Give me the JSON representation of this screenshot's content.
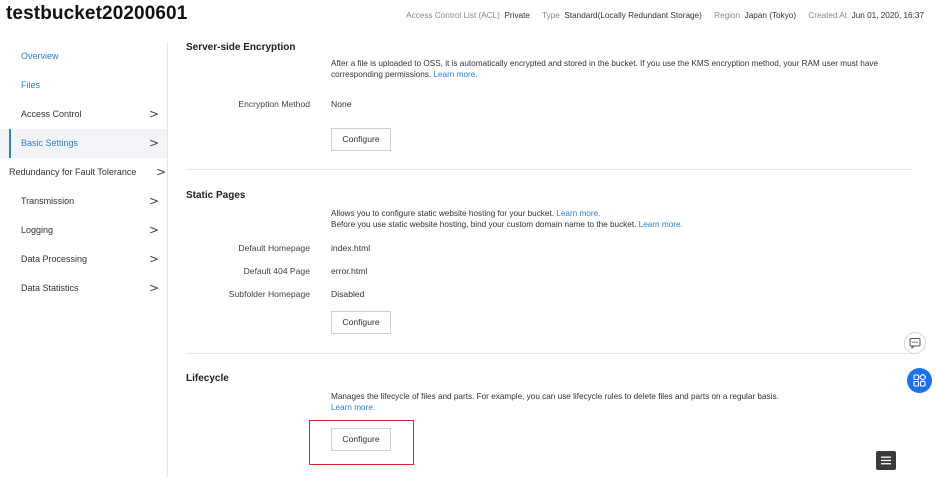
{
  "header": {
    "bucket_name": "testbucket20200601",
    "meta": [
      {
        "label": "Access Control List (ACL)",
        "value": "Private"
      },
      {
        "label": "Type",
        "value": "Standard(Locally Redundant Storage)"
      },
      {
        "label": "Region",
        "value": "Japan (Tokyo)"
      },
      {
        "label": "Created At",
        "value": "Jun 01, 2020, 16:37"
      }
    ]
  },
  "sidebar": {
    "items": [
      {
        "label": "Overview",
        "chevron": ""
      },
      {
        "label": "Files",
        "chevron": ""
      },
      {
        "label": "Access Control",
        "chevron": ">"
      },
      {
        "label": "Basic Settings",
        "chevron": ">"
      },
      {
        "label": "Redundancy for Fault Tolerance",
        "chevron": ">"
      },
      {
        "label": "Transmission",
        "chevron": ">"
      },
      {
        "label": "Logging",
        "chevron": ">"
      },
      {
        "label": "Data Processing",
        "chevron": ">"
      },
      {
        "label": "Data Statistics",
        "chevron": ">"
      }
    ],
    "active_index": 3
  },
  "encryption": {
    "title": "Server-side Encryption",
    "desc": "After a file is uploaded to OSS, it is automatically encrypted and stored in the bucket. If you use the KMS encryption method, your RAM user must have corresponding permissions.",
    "learn_more": "Learn more.",
    "method_label": "Encryption Method",
    "method_value": "None",
    "configure_label": "Configure"
  },
  "static_pages": {
    "title": "Static Pages",
    "desc_line1": "Allows you to configure static website hosting for your bucket.",
    "desc_line2": "Before you use static website hosting, bind your custom domain name to the bucket.",
    "learn_more": "Learn more.",
    "rows": [
      {
        "label": "Default Homepage",
        "value": "index.html"
      },
      {
        "label": "Default 404 Page",
        "value": "error.html"
      },
      {
        "label": "Subfolder Homepage",
        "value": "Disabled"
      }
    ],
    "configure_label": "Configure"
  },
  "lifecycle": {
    "title": "Lifecycle",
    "desc": "Manages the lifecycle of files and parts. For example, you can use lifecycle rules to delete files and parts on a regular basis.",
    "learn_more": "Learn more.",
    "configure_label": "Configure"
  },
  "floating": {
    "chat_icon": "chat-bubble-icon",
    "apps_icon": "apps-grid-icon",
    "menu_icon": "hamburger-menu-icon"
  },
  "colors": {
    "accent": "#2b7ed1",
    "highlight": "#e0252a",
    "apps_button": "#1a73e8"
  }
}
